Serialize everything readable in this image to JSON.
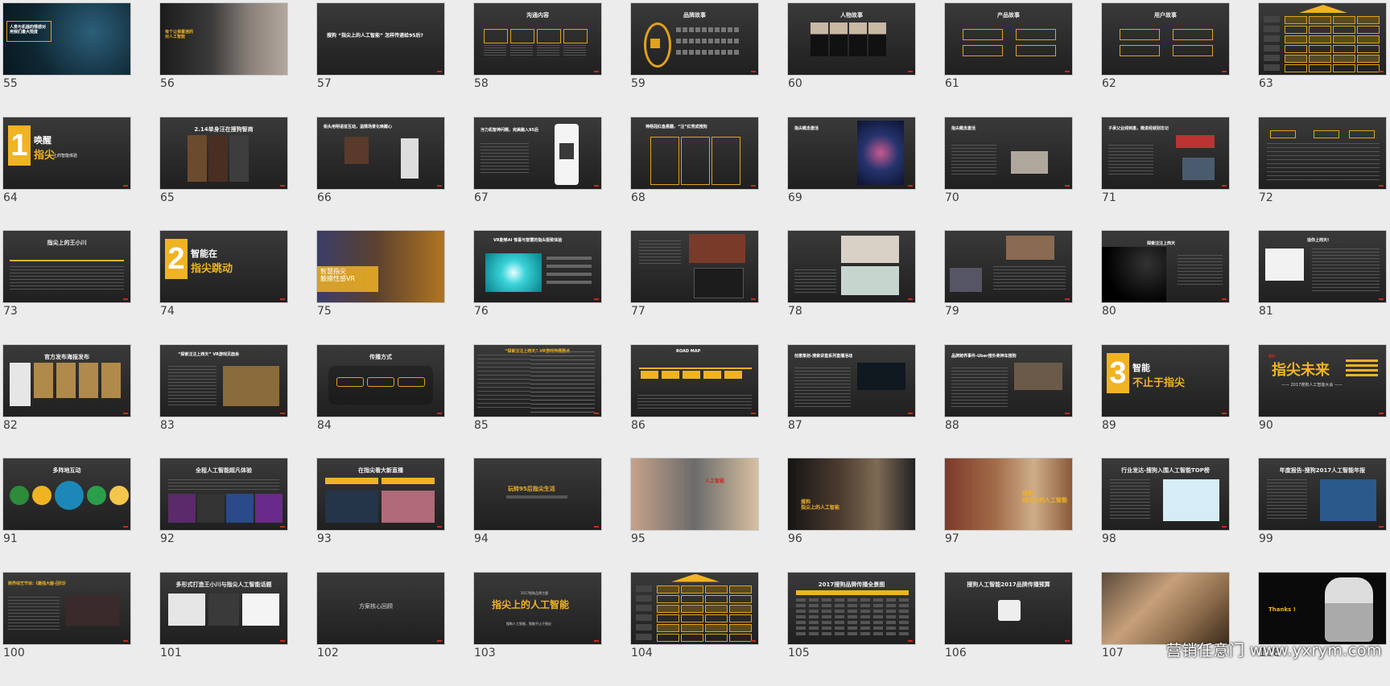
{
  "slides": [
    {
      "num": "55",
      "kind": "cover",
      "title": "人类与机器的情感对\n用我们最大限度",
      "sub": ""
    },
    {
      "num": "56",
      "kind": "hand",
      "title": "有个让我着迷的\n对人工智能",
      "sub": ""
    },
    {
      "num": "57",
      "kind": "centertitle",
      "title": "搜狗 “指尖上的人工智能” 怎样传递给95后?",
      "sub": ""
    },
    {
      "num": "58",
      "kind": "boxes4",
      "title": "沟通内容",
      "sub": ""
    },
    {
      "num": "59",
      "kind": "icons",
      "title": "品牌故事",
      "sub": ""
    },
    {
      "num": "60",
      "kind": "people",
      "title": "人物故事",
      "sub": ""
    },
    {
      "num": "61",
      "kind": "twoboxes",
      "title": "产品故事",
      "sub": ""
    },
    {
      "num": "62",
      "kind": "twoboxes",
      "title": "用户故事",
      "sub": ""
    },
    {
      "num": "63",
      "kind": "pyramid",
      "title": "",
      "sub": ""
    },
    {
      "num": "64",
      "kind": "bignum",
      "title": "唤醒",
      "sub": "指尖",
      "bignum": "1",
      "extra": "上的智能体验"
    },
    {
      "num": "65",
      "kind": "photos3",
      "title": "2.14单身汪在搜狗智商",
      "sub": ""
    },
    {
      "num": "66",
      "kind": "photophone",
      "title": "街头用明语音互动，温情场景化唤醒心",
      "sub": ""
    },
    {
      "num": "67",
      "kind": "phone",
      "title": "污力机智神问题，完美融入95后",
      "sub": ""
    },
    {
      "num": "68",
      "kind": "boxes3",
      "title": "神杨冠红盘悬翻，“汪”红荒成搜狗",
      "sub": ""
    },
    {
      "num": "69",
      "kind": "poster",
      "title": "指尖概念激活",
      "sub": ""
    },
    {
      "num": "70",
      "kind": "textphoto",
      "title": "指尖概念激活",
      "sub": ""
    },
    {
      "num": "71",
      "kind": "textphoto2",
      "title": "子承父业线到患，微进经就别忘记",
      "sub": ""
    },
    {
      "num": "72",
      "kind": "table",
      "title": "",
      "sub": ""
    },
    {
      "num": "73",
      "kind": "timeline",
      "title": "指尖上的王小川",
      "sub": ""
    },
    {
      "num": "74",
      "kind": "bignum",
      "title": "智能在",
      "sub": "指尖跳动",
      "bignum": "2",
      "extra": ""
    },
    {
      "num": "75",
      "kind": "vrphoto",
      "title": "智慧指尖\n触摸性感VR",
      "sub": ""
    },
    {
      "num": "76",
      "kind": "tunnel",
      "title": "VR能够AI 惊喜与智慧的指尖极致体验",
      "sub": ""
    },
    {
      "num": "77",
      "kind": "textphotos",
      "title": "",
      "sub": ""
    },
    {
      "num": "78",
      "kind": "cartoon",
      "title": "",
      "sub": ""
    },
    {
      "num": "79",
      "kind": "vrtimeline",
      "title": "",
      "sub": ""
    },
    {
      "num": "80",
      "kind": "space",
      "title": "探索汪汪上西天",
      "sub": ""
    },
    {
      "num": "81",
      "kind": "comic",
      "title": "适你上西天!",
      "sub": ""
    },
    {
      "num": "82",
      "kind": "posters",
      "title": "官方发布海报发布",
      "sub": ""
    },
    {
      "num": "83",
      "kind": "expo",
      "title": "“探索汪汪上西天” VR游戏见面会",
      "sub": ""
    },
    {
      "num": "84",
      "kind": "circles",
      "title": "传播方式",
      "sub": ""
    },
    {
      "num": "85",
      "kind": "roadmap",
      "title": "“探索汪汪上西天” VR游戏传播要点",
      "sub": ""
    },
    {
      "num": "86",
      "kind": "roadmap2",
      "title": "ROAD MAP",
      "sub": ""
    },
    {
      "num": "87",
      "kind": "event",
      "title": "创意策划-搜索讲直系列直播活动",
      "sub": ""
    },
    {
      "num": "88",
      "kind": "event2",
      "title": "品牌跨界事件-Uber搜外卖神车搜狗",
      "sub": ""
    },
    {
      "num": "89",
      "kind": "bignum",
      "title": "智能",
      "sub": "不止于指尖",
      "bignum": "3",
      "extra": ""
    },
    {
      "num": "90",
      "kind": "future",
      "title": "指尖未来",
      "sub": "—— 2017搜狗人工智能大会 ——"
    },
    {
      "num": "91",
      "kind": "bubbles",
      "title": "多阵地互动",
      "sub": ""
    },
    {
      "num": "92",
      "kind": "strip",
      "title": "全程人工智能超凡体验",
      "sub": ""
    },
    {
      "num": "93",
      "kind": "stage",
      "title": "在指尖看大新直播",
      "sub": ""
    },
    {
      "num": "94",
      "kind": "plain",
      "title": "玩转95后指尖生活",
      "sub": ""
    },
    {
      "num": "95",
      "kind": "young",
      "title": "",
      "sub": ""
    },
    {
      "num": "96",
      "kind": "girl",
      "title": "搜狗\n指尖上的人工智能",
      "sub": ""
    },
    {
      "num": "97",
      "kind": "group",
      "title": "搜狗\n指尖上的人工智能",
      "sub": ""
    },
    {
      "num": "98",
      "kind": "report",
      "title": "行业发达-搜狗入围人工智能TOP榜",
      "sub": ""
    },
    {
      "num": "99",
      "kind": "report2",
      "title": "年度报告-搜狗2017人工智能年报",
      "sub": ""
    },
    {
      "num": "100",
      "kind": "tvshow",
      "title": "跨界综艺节目:《最强大脑-回归》",
      "sub": ""
    },
    {
      "num": "101",
      "kind": "multi",
      "title": "多形式打造王小川与指尖人工智能话题",
      "sub": ""
    },
    {
      "num": "102",
      "kind": "plain2",
      "title": "方案核心回顾",
      "sub": ""
    },
    {
      "num": "103",
      "kind": "big",
      "title": "指尖上的人工智能",
      "sub": "搜狗人工智能，智能不止于指尖"
    },
    {
      "num": "104",
      "kind": "pyramid",
      "title": "",
      "sub": ""
    },
    {
      "num": "105",
      "kind": "gantt",
      "title": "2017搜狗品牌传播全景图",
      "sub": ""
    },
    {
      "num": "106",
      "kind": "device",
      "title": "搜狗人工智能2017品牌传播预算",
      "sub": ""
    },
    {
      "num": "107",
      "kind": "collage",
      "title": "",
      "sub": ""
    },
    {
      "num": "108",
      "kind": "robot",
      "title": "Thanks !",
      "sub": ""
    }
  ],
  "watermark": "营销任意门 www.yxrym.com",
  "colors": {
    "accent": "#f0b323",
    "bg": "#ececec",
    "slide": "#2b2b2b"
  }
}
